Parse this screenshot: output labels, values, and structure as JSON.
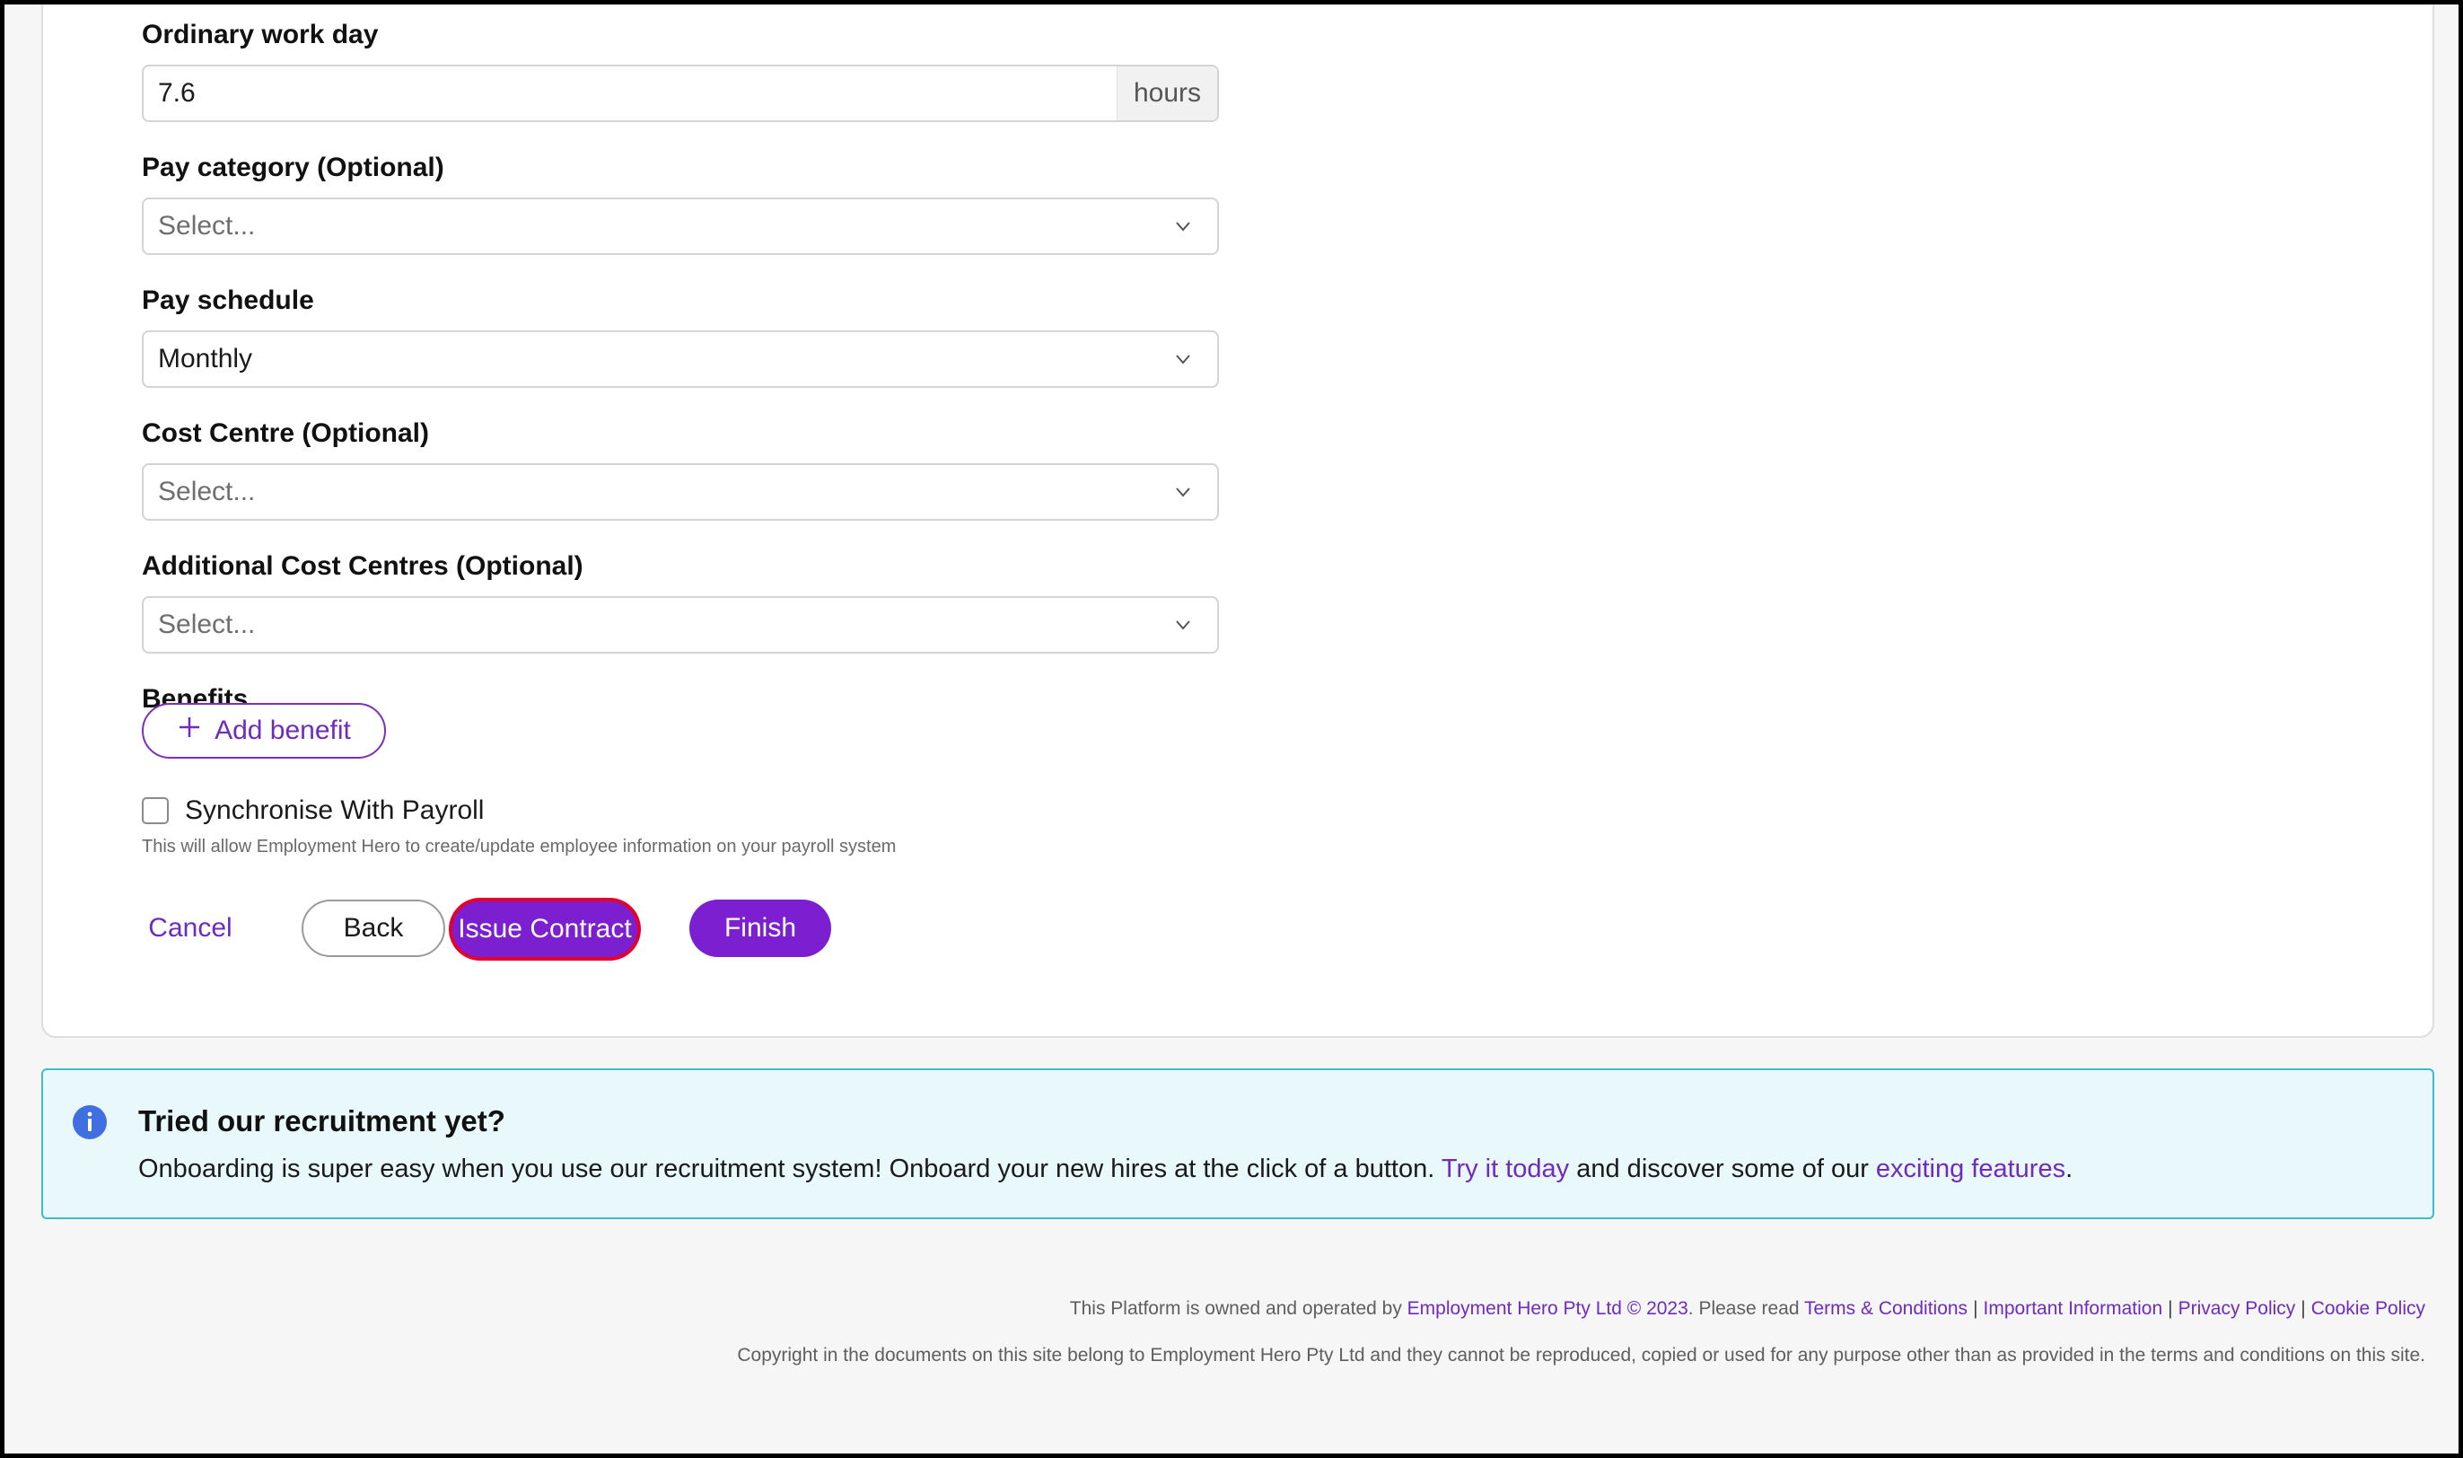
{
  "form": {
    "ordinary_work_day": {
      "label": "Ordinary work day",
      "value": "7.6",
      "suffix": "hours"
    },
    "pay_category": {
      "label": "Pay category (Optional)",
      "placeholder": "Select..."
    },
    "pay_schedule": {
      "label": "Pay schedule",
      "value": "Monthly"
    },
    "cost_centre": {
      "label": "Cost Centre (Optional)",
      "placeholder": "Select..."
    },
    "additional_cost_centres": {
      "label": "Additional Cost Centres (Optional)",
      "placeholder": "Select..."
    },
    "benefits": {
      "label": "Benefits",
      "add_label": "Add benefit"
    },
    "sync_payroll": {
      "label": "Synchronise With Payroll",
      "checked": false,
      "help": "This will allow Employment Hero to create/update employee information on your payroll system"
    }
  },
  "actions": {
    "cancel": "Cancel",
    "back": "Back",
    "issue_contract": "Issue Contract",
    "finish": "Finish"
  },
  "banner": {
    "title": "Tried our recruitment yet?",
    "text_1": "Onboarding is super easy when you use our recruitment system! Onboard your new hires at the click of a button. ",
    "link_1": "Try it today",
    "text_2": " and discover some of our ",
    "link_2": "exciting features",
    "text_3": "."
  },
  "footer": {
    "owned_prefix": "This Platform is owned and operated by ",
    "company_link": "Employment Hero Pty Ltd © 2023",
    "read_prefix": ". Please read ",
    "terms": "Terms & Conditions",
    "important": "Important Information",
    "privacy": "Privacy Policy",
    "cookie": "Cookie Policy",
    "separator": "|",
    "copyright": "Copyright in the documents on this site belong to Employment Hero Pty Ltd and they cannot be reproduced, copied or used for any purpose other than as provided in the terms and conditions on this site."
  },
  "colors": {
    "accent": "#7b1fd1",
    "link": "#6f2bbd",
    "focus_ring": "#e4002b",
    "banner_bg": "#e8f8fb",
    "banner_border": "#3bbdcb",
    "info_icon": "#3f6fe0"
  },
  "icons": {
    "select_chevron": "chevron-down-icon",
    "add": "plus-icon",
    "info": "info-icon"
  }
}
